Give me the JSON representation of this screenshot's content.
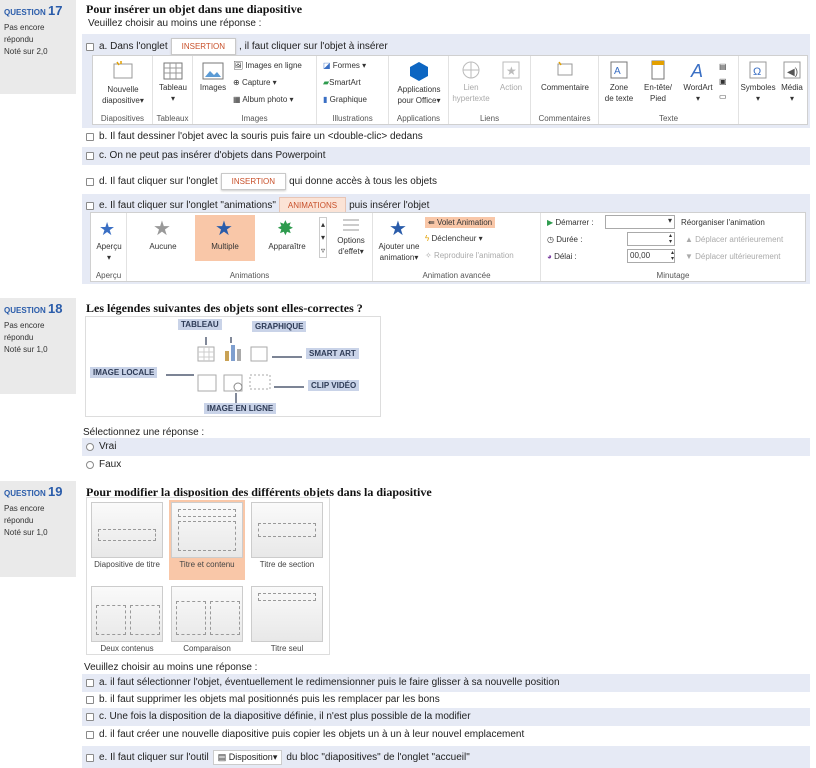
{
  "q17": {
    "label": "QUESTION",
    "num": "17",
    "status": "Pas encore répondu",
    "grade": "Noté sur 2,0",
    "title": "Pour insérer un objet dans une diapositive",
    "instruction": "Veuillez choisir au moins une réponse :",
    "a_pre": "a. Dans l'onglet",
    "a_tab": "INSERTION",
    "a_post": ", il faut cliquer sur l'objet à insérer",
    "b": "b. Il faut dessiner l'objet avec la souris puis faire un <double-clic> dedans",
    "c": "c. On ne peut pas insérer d'objets dans Powerpoint",
    "d_pre": "d. Il faut cliquer sur l'onglet",
    "d_tab": "INSERTION",
    "d_post": "qui donne accès à tous les objets",
    "e_pre": "e. Il faut cliquer sur l'onglet \"animations\"",
    "e_tab": "ANIMATIONS",
    "e_post": "puis insérer l'objet"
  },
  "ribbon1": {
    "nouvelle": "Nouvelle",
    "diapositive": "diapositive",
    "grp_diapositives": "Diapositives",
    "tableau": "Tableau",
    "grp_tableaux": "Tableaux",
    "images": "Images",
    "images_en_ligne": "Images en ligne",
    "capture": "Capture",
    "album": "Album photo",
    "grp_images": "Images",
    "formes": "Formes",
    "smartart": "SmartArt",
    "graphique": "Graphique",
    "grp_illustrations": "Illustrations",
    "applications": "Applications",
    "pour_office": "pour Office",
    "grp_applications": "Applications",
    "lien": "Lien",
    "hypertexte": "hypertexte",
    "action": "Action",
    "grp_liens": "Liens",
    "commentaire": "Commentaire",
    "grp_commentaires": "Commentaires",
    "zone": "Zone",
    "de_texte": "de texte",
    "entete": "En-tête/",
    "pied": "Pied",
    "wordart": "WordArt",
    "grp_texte": "Texte",
    "symboles": "Symboles",
    "media": "Média"
  },
  "ribbon2": {
    "apercu": "Aperçu",
    "grp_apercu": "Aperçu",
    "aucune": "Aucune",
    "multiple": "Multiple",
    "apparaitre": "Apparaître",
    "options": "Options",
    "deffet": "d'effet",
    "grp_animations": "Animations",
    "ajouter": "Ajouter une",
    "animation": "animation",
    "volet": "Volet Animation",
    "declencheur": "Déclencheur",
    "reproduire": "Reproduire l'animation",
    "grp_avancee": "Animation avancée",
    "demarrer": "Démarrer :",
    "duree": "Durée :",
    "delai": "Délai :",
    "delai_val": "00,00",
    "reorganiser": "Réorganiser l'animation",
    "anterieurement": "Déplacer antérieurement",
    "ulterieurement": "Déplacer ultérieurement",
    "grp_minutage": "Minutage"
  },
  "q18": {
    "label": "QUESTION",
    "num": "18",
    "status": "Pas encore répondu",
    "grade": "Noté sur 1,0",
    "title": "Les légendes suivantes des objets sont elles-correctes ?",
    "tableau": "TABLEAU",
    "graphique": "GRAPHIQUE",
    "smartart": "SMART ART",
    "image_locale": "IMAGE LOCALE",
    "clip": "CLIP VIDÉO",
    "image_ligne": "IMAGE EN LIGNE",
    "instruction": "Sélectionnez une réponse :",
    "vrai": "Vrai",
    "faux": "Faux"
  },
  "q19": {
    "label": "QUESTION",
    "num": "19",
    "status": "Pas encore répondu",
    "grade": "Noté sur 1,0",
    "title": "Pour modifier la disposition des différents objets dans la diapositive",
    "layouts": [
      "Diapositive de titre",
      "Titre et contenu",
      "Titre de section",
      "Deux contenus",
      "Comparaison",
      "Titre seul"
    ],
    "instruction": "Veuillez choisir au moins une réponse :",
    "a": "a. il faut sélectionner l'objet, éventuellement le redimensionner puis le faire glisser à sa nouvelle position",
    "b": "b. il faut supprimer les objets mal positionnés puis les remplacer par les bons",
    "c": "c. Une fois la disposition de la diapositive définie, il n'est plus possible de la modifier",
    "d": "d. il faut créer une nouvelle diapositive puis copier les objets un à un à leur nouvel emplacement",
    "e_pre": "e. Il faut cliquer sur l'outil",
    "e_tool": "Disposition",
    "e_post": "du bloc \"diapositives\" de l'onglet \"accueil\""
  },
  "colors": {
    "accent": "#2a5caa",
    "band": "#e6eaf5",
    "selected": "#f9c7a8"
  }
}
